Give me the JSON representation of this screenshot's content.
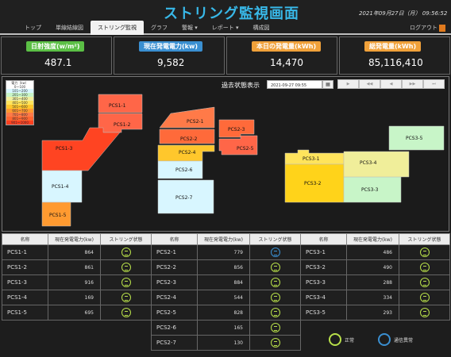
{
  "header": {
    "title": "ストリング監視画面",
    "datetime": "2021年09月27日（月） 09:56:52",
    "logout_label": "ログアウト",
    "nav": [
      {
        "label": "トップ",
        "active": false
      },
      {
        "label": "単線結線図",
        "active": false
      },
      {
        "label": "ストリング監視",
        "active": true
      },
      {
        "label": "グラフ",
        "active": false
      },
      {
        "label": "警報 ▾",
        "active": false
      },
      {
        "label": "レポート ▾",
        "active": false
      },
      {
        "label": "構成図",
        "active": false
      }
    ]
  },
  "kpis": [
    {
      "label": "日射強度(w/m²)",
      "value": "487.1",
      "color": "#5bbf45"
    },
    {
      "label": "現在発電電力(kw)",
      "value": "9,582",
      "color": "#3a8fd1"
    },
    {
      "label": "本日の発電量(kWh)",
      "value": "14,470",
      "color": "#f0a13a"
    },
    {
      "label": "総発電量(kWh)",
      "value": "85,116,410",
      "color": "#f0a13a"
    }
  ],
  "map": {
    "past_label": "過去状態表示",
    "datetime_value": "2021-09-27 09:55",
    "calendar_icon": "calendar-icon",
    "controls": [
      "▶",
      "◀◀",
      "◀",
      "▶▶",
      "⏭"
    ],
    "legend": {
      "title": "電力（kw）",
      "ranges": [
        {
          "label": "0～100",
          "color": "#ffffff"
        },
        {
          "label": "101～200",
          "color": "#d8f6ff"
        },
        {
          "label": "201～300",
          "color": "#c8f5c8"
        },
        {
          "label": "301～400",
          "color": "#f0eea0"
        },
        {
          "label": "401～500",
          "color": "#ffe45c"
        },
        {
          "label": "501～600",
          "color": "#ffc72c"
        },
        {
          "label": "601～700",
          "color": "#ff9a30"
        },
        {
          "label": "701～800",
          "color": "#ff7a48"
        },
        {
          "label": "801～900",
          "color": "#ff6630"
        },
        {
          "label": "901～1000",
          "color": "#ff4020"
        }
      ]
    },
    "labels": {
      "PCS1-1": "PCS1-1",
      "PCS1-2": "PCS1-2",
      "PCS1-3": "PCS1-3",
      "PCS1-4": "PCS1-4",
      "PCS1-5": "PCS1-5",
      "PCS2-1": "PCS2-1",
      "PCS2-2": "PCS2-2",
      "PCS2-3": "PCS2-3",
      "PCS2-4": "PCS2-4",
      "PCS2-5": "PCS2-5",
      "PCS2-6": "PCS2-6",
      "PCS2-7": "PCS2-7",
      "PCS3-1": "PCS3-1",
      "PCS3-2": "PCS3-2",
      "PCS3-3": "PCS3-3",
      "PCS3-4": "PCS3-4",
      "PCS3-5": "PCS3-5"
    }
  },
  "table_headers": [
    "名称",
    "現在発電電力(kw)",
    "ストリング状態"
  ],
  "tables": [
    [
      {
        "name": "PCS1-1",
        "power": "864",
        "status": "ok"
      },
      {
        "name": "PCS1-2",
        "power": "861",
        "status": "ok"
      },
      {
        "name": "PCS1-3",
        "power": "916",
        "status": "ok"
      },
      {
        "name": "PCS1-4",
        "power": "169",
        "status": "ok"
      },
      {
        "name": "PCS1-5",
        "power": "695",
        "status": "ok"
      }
    ],
    [
      {
        "name": "PCS2-1",
        "power": "779",
        "status": "err"
      },
      {
        "name": "PCS2-2",
        "power": "856",
        "status": "ok"
      },
      {
        "name": "PCS2-3",
        "power": "884",
        "status": "ok"
      },
      {
        "name": "PCS2-4",
        "power": "544",
        "status": "ok"
      },
      {
        "name": "PCS2-5",
        "power": "828",
        "status": "ok"
      },
      {
        "name": "PCS2-6",
        "power": "165",
        "status": "ok"
      },
      {
        "name": "PCS2-7",
        "power": "130",
        "status": "ok"
      }
    ],
    [
      {
        "name": "PCS3-1",
        "power": "486",
        "status": "ok"
      },
      {
        "name": "PCS3-2",
        "power": "490",
        "status": "ok"
      },
      {
        "name": "PCS3-3",
        "power": "288",
        "status": "ok"
      },
      {
        "name": "PCS3-4",
        "power": "334",
        "status": "ok"
      },
      {
        "name": "PCS3-5",
        "power": "293",
        "status": "ok"
      }
    ]
  ],
  "status_legend": {
    "ok": "正常",
    "err": "通信異常"
  }
}
